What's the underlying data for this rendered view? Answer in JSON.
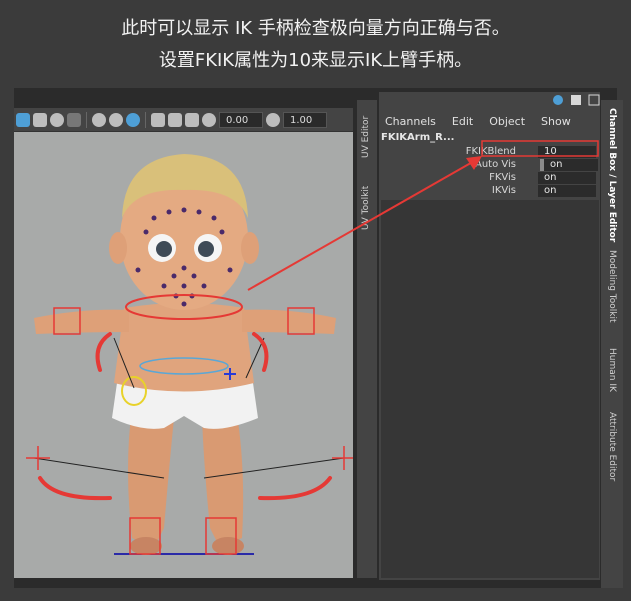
{
  "caption": {
    "line1": "此时可以显示 IK 手柄检查极向量方向正确与否。",
    "line2": "设置FKIK属性为10来显示IK上臂手柄。"
  },
  "viewport_toolbar": {
    "field1": "0.00",
    "field2": "1.00"
  },
  "left_tabs": [
    "UV Editor",
    "UV Toolkit"
  ],
  "right_tabs": [
    "Channel Box / Layer Editor",
    "Modeling Toolkit",
    "Human IK",
    "Attribute Editor"
  ],
  "channel_box": {
    "menu": [
      "Channels",
      "Edit",
      "Object",
      "Show"
    ],
    "object_name": "FKIKArm_R...",
    "attributes": [
      {
        "label": "FKIKBlend",
        "value": "10"
      },
      {
        "label": "Auto Vis",
        "value": "on"
      },
      {
        "label": "FKVis",
        "value": "on"
      },
      {
        "label": "IKVis",
        "value": "on"
      }
    ]
  },
  "colors": {
    "annotation_red": "#e53935",
    "viewport_bg": "#a8aaa9",
    "panel_bg": "#444444"
  },
  "icons": [
    "render-view-icon",
    "light-icon",
    "grid-icon",
    "camera-icon",
    "channel-box-pin-icon"
  ]
}
